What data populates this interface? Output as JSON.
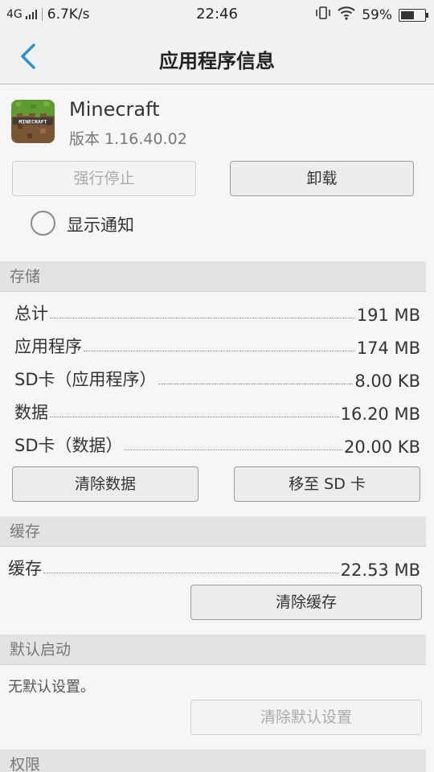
{
  "status_bar": {
    "network": "4G",
    "speed": "6.7K/s",
    "time": "22:46",
    "battery": "59%",
    "battery_level": 0.59
  },
  "header": {
    "title": "应用程序信息"
  },
  "app": {
    "name": "Minecraft",
    "version": "版本 1.16.40.02",
    "icon_text": "MINECRAFT"
  },
  "actions": {
    "force_stop": "强行停止",
    "uninstall": "卸载"
  },
  "notification": {
    "label": "显示通知",
    "checked": false
  },
  "storage": {
    "header": "存储",
    "rows": [
      {
        "label": "总计",
        "value": "191 MB"
      },
      {
        "label": "应用程序",
        "value": "174 MB"
      },
      {
        "label": "SD卡（应用程序）",
        "value": "8.00 KB"
      },
      {
        "label": "数据",
        "value": "16.20 MB"
      },
      {
        "label": "SD卡（数据）",
        "value": "20.00 KB"
      }
    ],
    "clear_data": "清除数据",
    "move_to_sd": "移至 SD 卡"
  },
  "cache": {
    "header": "缓存",
    "label": "缓存",
    "value": "22.53 MB",
    "clear_cache": "清除缓存"
  },
  "default_launch": {
    "header": "默认启动",
    "text": "无默认设置。",
    "clear_defaults": "清除默认设置"
  },
  "permissions": {
    "header": "权限"
  },
  "colors": {
    "accent": "#2a8fd8"
  }
}
